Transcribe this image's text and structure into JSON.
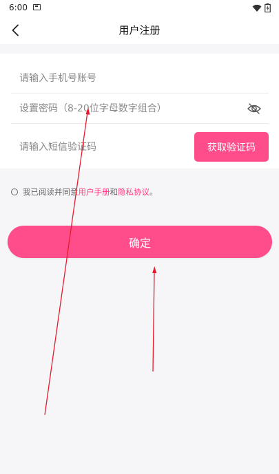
{
  "status_bar": {
    "time": "6:00",
    "icons": [
      "notification-icon",
      "wifi-icon",
      "battery-charging-icon"
    ]
  },
  "header": {
    "title": "用户注册",
    "back_icon": "chevron-left-icon"
  },
  "form": {
    "phone_placeholder": "请输入手机号账号",
    "password_placeholder": "设置密码（8-20位字母数字组合）",
    "sms_code_placeholder": "请输入短信验证码",
    "get_code_label": "获取验证码",
    "toggle_password_icon": "eye-icon"
  },
  "agreement": {
    "prefix": "我已阅读并同意",
    "manual_link": "用户手册",
    "conjunction": "和",
    "privacy_link": "隐私协议",
    "suffix": "。"
  },
  "confirm_label": "确定",
  "colors": {
    "accent": "#ff4d8b",
    "link": "#ff3b7f",
    "background": "#f6f6f8",
    "annotation_arrow": "#e8192c"
  }
}
